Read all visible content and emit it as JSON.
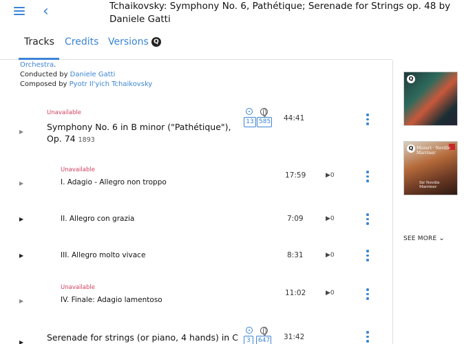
{
  "header": {
    "title": "Tchaikovsky: Symphony No. 6, Pathétique; Serenade for Strings op. 48 by Daniele Gatti",
    "menu_icon": "hamburger-menu-icon",
    "back_icon": "chevron-left-icon"
  },
  "tabs": [
    {
      "label": "Tracks",
      "active": true
    },
    {
      "label": "Credits",
      "active": false
    },
    {
      "label": "Versions",
      "active": false
    }
  ],
  "credits": {
    "orchestra_tail": "Orchestra",
    "conducted_prefix": "Conducted by ",
    "conductor": "Daniele Gatti",
    "composed_prefix": "Composed by ",
    "composer": "Pyotr Il'yich Tchaikovsky"
  },
  "works": [
    {
      "status": "Unavailable",
      "title": "Symphony No. 6 in B minor (\"Pathétique\"), Op. 74",
      "year": "1893",
      "recordings_count": "13",
      "performers_count": "585",
      "duration": "44:41",
      "movements": [
        {
          "status": "Unavailable",
          "title": "I. Adagio - Allegro non troppo",
          "duration": "17:59",
          "plays": "0"
        },
        {
          "status": "",
          "title": "II. Allegro con grazia",
          "duration": "7:09",
          "plays": "0"
        },
        {
          "status": "",
          "title": "III. Allegro molto vivace",
          "duration": "8:31",
          "plays": "0"
        },
        {
          "status": "Unavailable",
          "title": "IV. Finale: Adagio lamentoso",
          "duration": "11:02",
          "plays": "0"
        }
      ]
    },
    {
      "status": "",
      "title": "Serenade for strings (or piano, 4 hands) in C",
      "recordings_count": "3",
      "performers_count": "647",
      "duration": "31:42"
    }
  ],
  "sidebar": {
    "see_more_label": "SEE MORE",
    "cover2_caption": "Mozart · Neville Marriner",
    "cover2_caption2": "Sir Neville Marriner"
  },
  "colors": {
    "accent": "#3a84d6",
    "unavailable": "#d04060"
  }
}
